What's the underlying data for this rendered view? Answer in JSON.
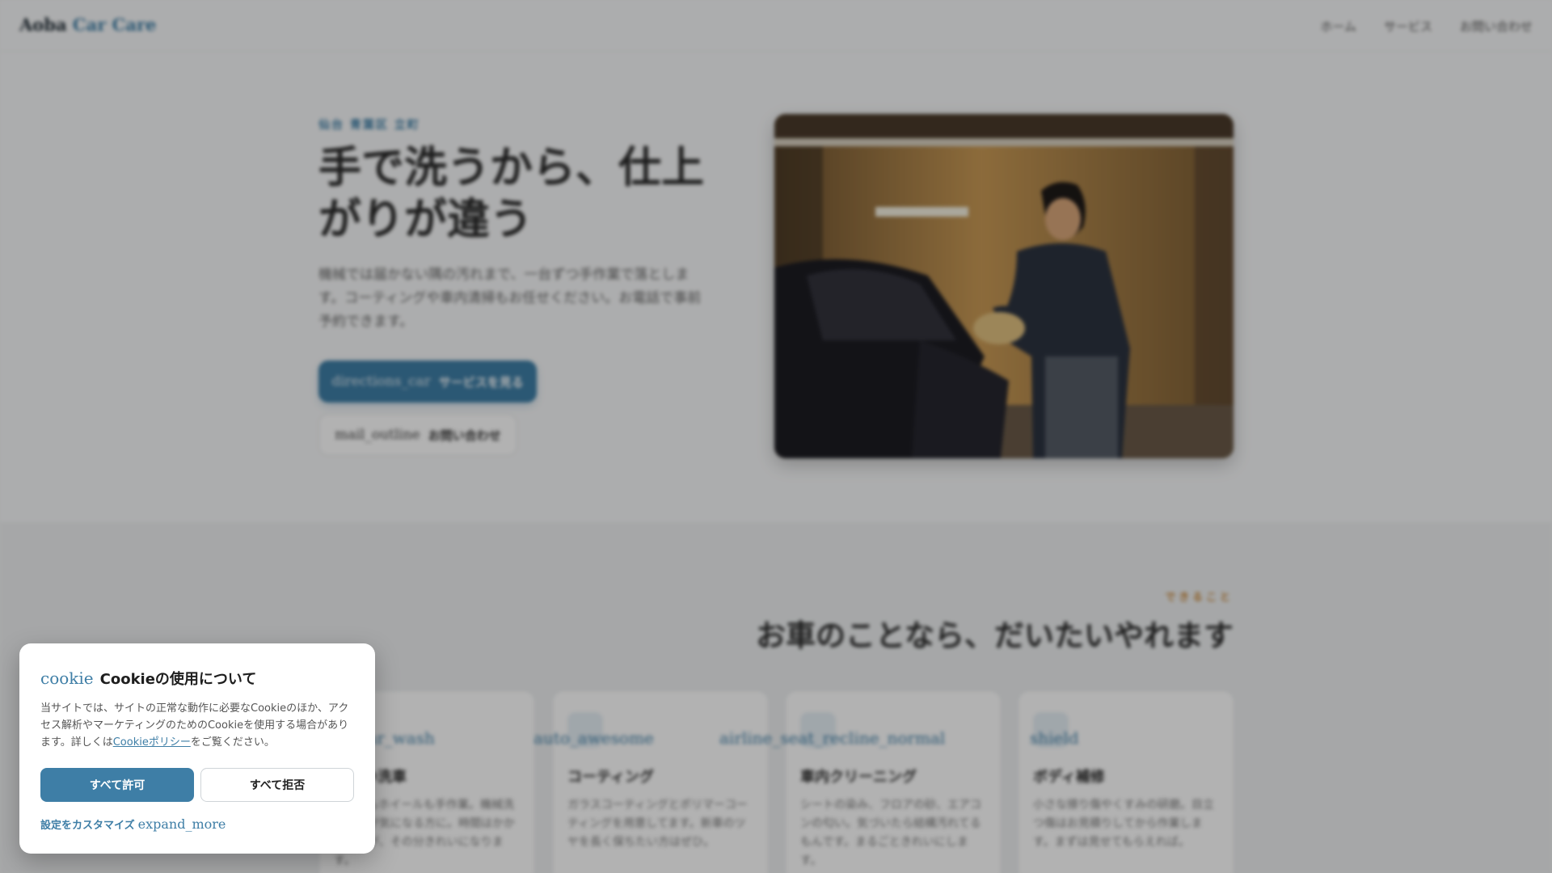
{
  "navbar": {
    "logo_main": "Aoba",
    "logo_accent": "Car Care",
    "links": [
      "ホーム",
      "サービス",
      "お問い合わせ"
    ]
  },
  "hero": {
    "eyebrow": "仙台 青葉区 立町",
    "title": "手で洗うから、仕上がりが違う",
    "description": "機械では届かない隅の汚れまで、一台ずつ手作業で落とします。コーティングや車内清掃もお任せください。お電話で事前予約できます。",
    "primary_button": {
      "icon": "directions_car",
      "label": "サービスを見る"
    },
    "secondary_button": {
      "icon": "mail_outline",
      "label": "お問い合わせ"
    }
  },
  "services": {
    "eyebrow": "できること",
    "title": "お車のことなら、だいたいやれます",
    "cards": [
      {
        "icon": "local_car_wash",
        "title": "手洗い洗車",
        "description": "ボディもホイールも手作業。機械洗車の傷が気になる方に。時間はかかりますが、その分きれいになります。"
      },
      {
        "icon": "auto_awesome",
        "title": "コーティング",
        "description": "ガラスコーティングとポリマーコーティングを用意してます。新車のツヤを長く保ちたい方はぜひ。"
      },
      {
        "icon": "airline_seat_recline_normal",
        "title": "車内クリーニング",
        "description": "シートの染み、フロアの砂、エアコンの匂い。気づいたら結構汚れてるもんです。まるごときれいにします。"
      },
      {
        "icon": "shield",
        "title": "ボディ補修",
        "description": "小さな擦り傷やくすみの研磨。目立つ傷はお見積りしてから作業します。まずは見せてもらえれば。"
      }
    ]
  },
  "cookie": {
    "icon": "cookie",
    "title": "Cookieの使用について",
    "body_before": "当サイトでは、サイトの正常な動作に必要なCookieのほか、アクセス解析やマーケティングのためのCookieを使用する場合があります。詳しくは",
    "policy_link": "Cookieポリシー",
    "body_after": "をご覧ください。",
    "accept_label": "すべて許可",
    "reject_label": "すべて拒否",
    "customize_label": "設定をカスタマイズ",
    "customize_icon": "expand_more"
  },
  "colors": {
    "accent": "#3e7ea6",
    "eyebrow_orange": "#c9883a"
  }
}
